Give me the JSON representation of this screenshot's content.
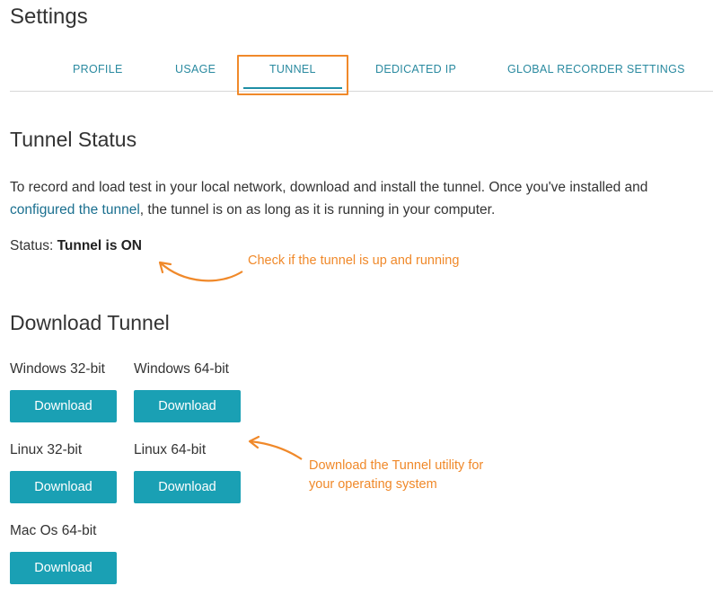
{
  "page": {
    "title": "Settings"
  },
  "tabs": [
    {
      "label": "PROFILE",
      "active": false
    },
    {
      "label": "USAGE",
      "active": false
    },
    {
      "label": "TUNNEL",
      "active": true
    },
    {
      "label": "DEDICATED IP",
      "active": false
    },
    {
      "label": "GLOBAL RECORDER SETTINGS",
      "active": false
    }
  ],
  "tunnel_status": {
    "heading": "Tunnel Status",
    "description_before": "To record and load test in your local network, download and install the tunnel. Once you've installed and ",
    "description_link": "configured the tunnel",
    "description_after": ", the tunnel is on as long as it is running in your computer.",
    "status_label": "Status:",
    "status_value": "Tunnel is ON"
  },
  "annotations": {
    "status_note": "Check if the tunnel is up and running",
    "download_note_line1": "Download the Tunnel utility for",
    "download_note_line2": "your operating system"
  },
  "download": {
    "heading": "Download Tunnel",
    "items": [
      {
        "os": "Windows 32-bit",
        "button": "Download"
      },
      {
        "os": "Windows 64-bit",
        "button": "Download"
      },
      {
        "os": "Linux 32-bit",
        "button": "Download"
      },
      {
        "os": "Linux 64-bit",
        "button": "Download"
      },
      {
        "os": "Mac Os 64-bit",
        "button": "Download"
      }
    ]
  },
  "colors": {
    "accent": "#1aa0b4",
    "link": "#1a6f8f",
    "annotation": "#f0892a"
  }
}
